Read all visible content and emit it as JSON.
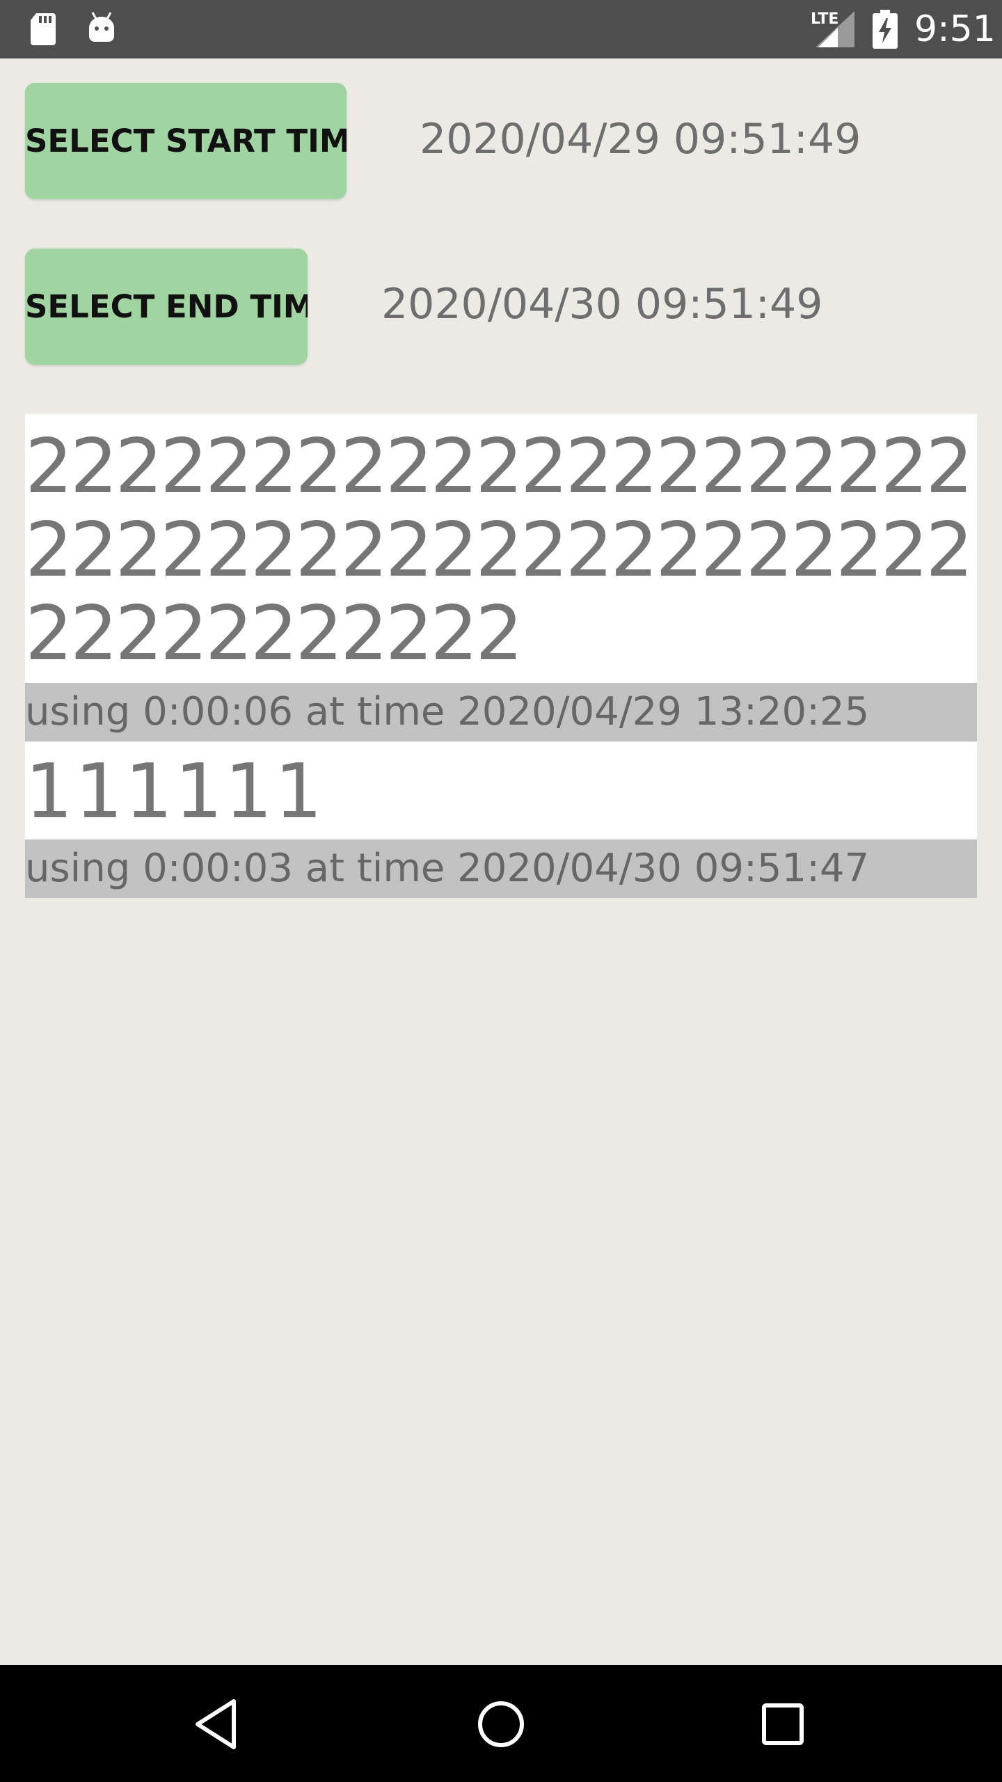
{
  "status_bar": {
    "clock": "9:51",
    "network": "LTE",
    "icons": [
      "sd-card-icon",
      "android-icon",
      "signal-icon",
      "battery-charging-icon"
    ]
  },
  "selectors": {
    "start_button_label": "SELECT START TIME",
    "start_time": "2020/04/29 09:51:49",
    "end_button_label": "SELECT END TIME",
    "end_time": "2020/04/30 09:51:49"
  },
  "records": [
    {
      "title": "22222222222222222222222222222222222222222222222222222",
      "meta": "using 0:00:06 at time 2020/04/29 13:20:25"
    },
    {
      "title": "111111",
      "meta": "using 0:00:03 at time 2020/04/30 09:51:47"
    }
  ],
  "nav_bar": {
    "icons": [
      "back-icon",
      "home-icon",
      "recents-icon"
    ]
  },
  "colors": {
    "background": "#EBEAE4",
    "button": "#A0D5A1",
    "meta_row": "#C3C2C2",
    "status_bar": "#4E4E4E"
  }
}
